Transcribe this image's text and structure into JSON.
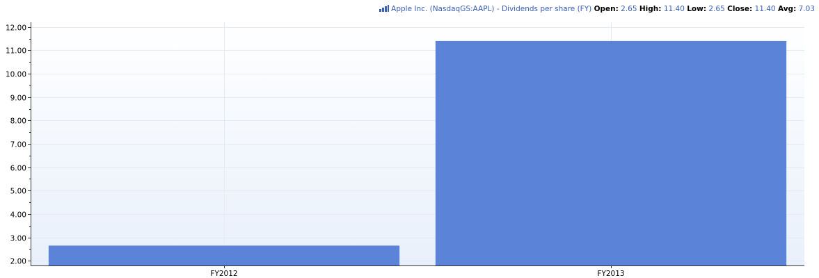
{
  "legend": {
    "icon": "bar-chart-icon",
    "series_name": "Apple Inc. (NasdaqGS:AAPL) - Dividends per share (FY)",
    "open_label": "Open:",
    "open_value": "2.65",
    "high_label": "High:",
    "high_value": "11.40",
    "low_label": "Low:",
    "low_value": "2.65",
    "close_label": "Close:",
    "close_value": "11.40",
    "avg_label": "Avg:",
    "avg_value": "7.03"
  },
  "colors": {
    "bar": "#5b84d8",
    "plot_bg_top": "#ffffff",
    "plot_bg_bottom": "#e8f0fb",
    "axis": "#333333",
    "grid": "#e6ebf2",
    "accent_text": "#3a5fb8"
  },
  "chart_data": {
    "type": "bar",
    "categories": [
      "FY2012",
      "FY2013"
    ],
    "series": [
      {
        "values": [
          2.65,
          11.4
        ]
      }
    ],
    "ylim": [
      1.8,
      12.2
    ],
    "yticks": [
      2,
      3,
      4,
      5,
      6,
      7,
      8,
      9,
      10,
      11,
      12
    ],
    "ytick_labels": [
      "2.00",
      "3.00",
      "4.00",
      "5.00",
      "6.00",
      "7.00",
      "8.00",
      "9.00",
      "10.00",
      "11.00",
      "12.00"
    ],
    "grid": true,
    "legend_position": "top-right"
  }
}
